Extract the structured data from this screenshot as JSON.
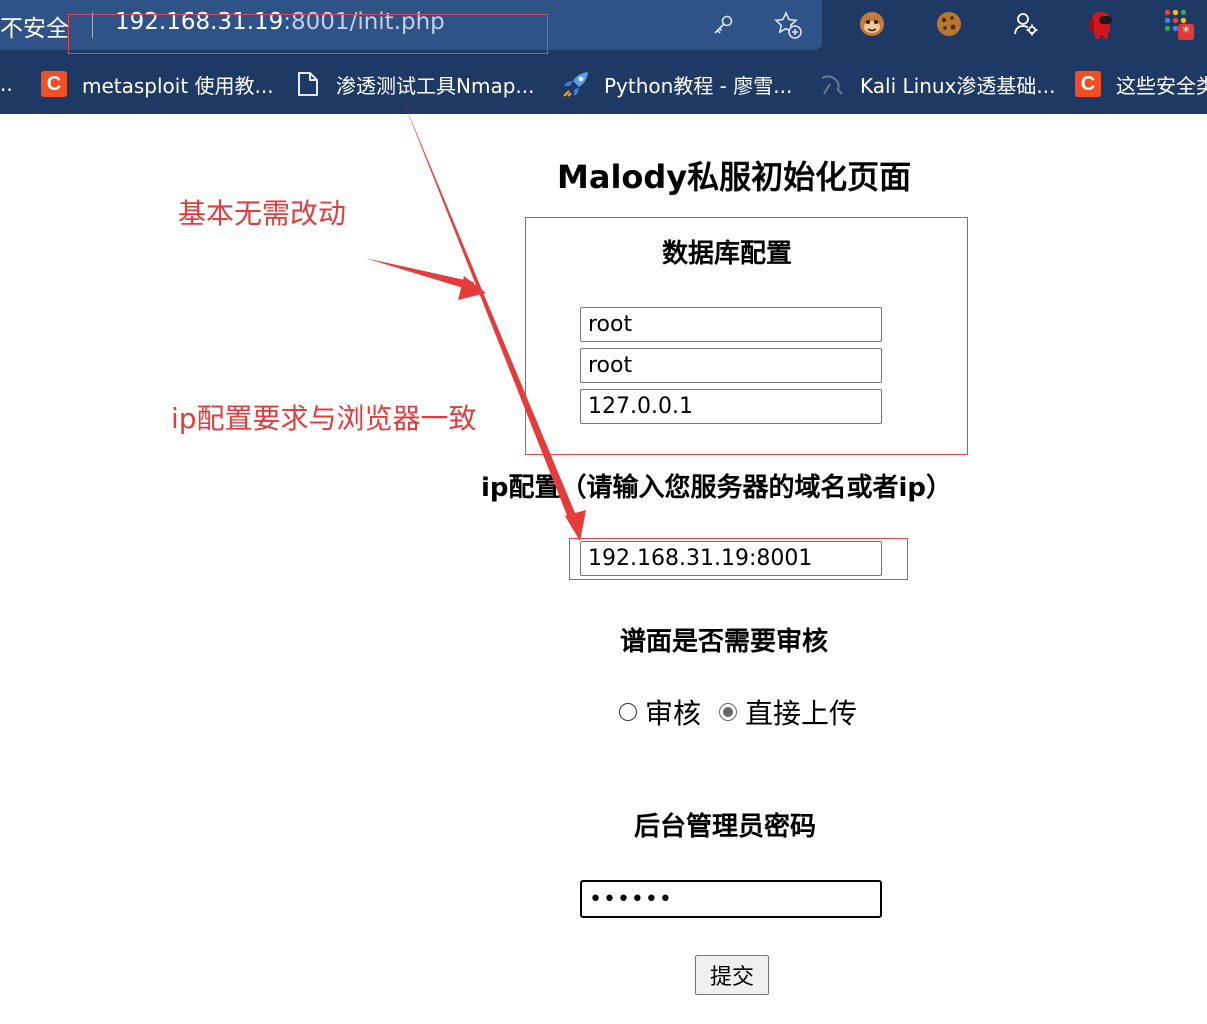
{
  "browser": {
    "security_label": "不安全",
    "url_host": "192.168.31.19",
    "url_rest": ":8001/init.php",
    "address_icons": [
      "key-icon",
      "add-favorite-icon"
    ],
    "extensions": [
      "monkey-extension-icon",
      "cookie-extension-icon",
      "user-settings-icon",
      "among-us-extension-icon",
      "apps-grid-icon"
    ]
  },
  "bookmarks": [
    {
      "label": "metasploit 使用教...",
      "icon": "csdn-icon"
    },
    {
      "label": "渗透测试工具Nmap...",
      "icon": "document-icon"
    },
    {
      "label": "Python教程 - 廖雪...",
      "icon": "rocket-icon"
    },
    {
      "label": "Kali Linux渗透基础...",
      "icon": "kali-icon"
    },
    {
      "label": "这些安全类",
      "icon": "csdn-icon"
    }
  ],
  "bookmarks_overflow": "..",
  "page": {
    "title": "Malody私服初始化页面",
    "db_heading": "数据库配置",
    "db_user": "root",
    "db_password": "root",
    "db_host": "127.0.0.1",
    "ip_heading": "ip配置（请输入您服务器的域名或者ip）",
    "ip_value": "192.168.31.19:8001",
    "review_heading": "谱面是否需要审核",
    "review_options": [
      "审核",
      "直接上传"
    ],
    "review_selected": "直接上传",
    "admin_heading": "后台管理员密码",
    "admin_password_mask": "••••••",
    "submit_label": "提交"
  },
  "annotations": {
    "note1": "基本无需改动",
    "note2": "ip配置要求与浏览器一致",
    "color": "#e63b3b"
  }
}
